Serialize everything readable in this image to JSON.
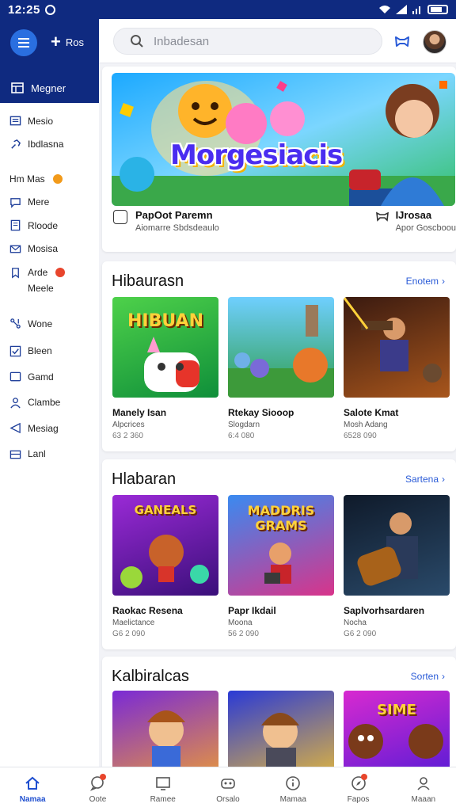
{
  "status_bar": {
    "time": "12:25"
  },
  "sidebar": {
    "new_label": "Ros",
    "active_item": "Megner",
    "items": [
      {
        "label": "Mesio",
        "icon": "list-icon"
      },
      {
        "label": "Ibdlasna",
        "icon": "link-icon"
      },
      {
        "label": "Hm Mas",
        "icon": "",
        "badge": true
      },
      {
        "label": "Mere",
        "icon": "chat-icon"
      },
      {
        "label": "Rloode",
        "icon": "document-icon"
      },
      {
        "label": "Mosisa",
        "icon": "mail-icon"
      },
      {
        "label": "Arde",
        "icon": "bookmark-icon",
        "badge": true
      },
      {
        "label": "Meele",
        "icon": ""
      },
      {
        "label": "Wone",
        "icon": "network-icon"
      },
      {
        "label": "Bleen",
        "icon": "check-icon"
      },
      {
        "label": "Gamd",
        "icon": "square-icon"
      },
      {
        "label": "Clambe",
        "icon": "person-icon"
      },
      {
        "label": "Mesiag",
        "icon": "send-icon"
      },
      {
        "label": "Lanl",
        "icon": "inbox-icon"
      }
    ]
  },
  "search": {
    "placeholder": "Inbadesan"
  },
  "hero": {
    "title": "Morgesiacis",
    "left_name": "PapOot Paremn",
    "left_sub": "Aiomarre Sbdsdeaulo",
    "right_name": "IJrosaa",
    "right_sub": "Apor Goscboou"
  },
  "sections": [
    {
      "title": "Hibaurasn",
      "see_all": "Enotem",
      "tiles": [
        {
          "name": "Manely Isan",
          "sub": "Alpcrices",
          "meta": "63 2 360",
          "img_label": "HIBUAN"
        },
        {
          "name": "Rtekay Siooop",
          "sub": "Slogdarn",
          "meta": "6:4 080",
          "img_label": ""
        },
        {
          "name": "Salote Kmat",
          "sub": "Mosh Adang",
          "meta": "6528 090",
          "img_label": ""
        }
      ]
    },
    {
      "title": "Hlabaran",
      "see_all": "Sartena",
      "tiles": [
        {
          "name": "Raokac Resena",
          "sub": "Maelictance",
          "meta": "G6 2 090",
          "img_label": "GANEALS"
        },
        {
          "name": "Papr Ikdail",
          "sub": "Moona",
          "meta": "56 2 090",
          "img_label": "MADDRIS GRAMS"
        },
        {
          "name": "Saplvorhsardaren",
          "sub": "Nocha",
          "meta": "G6 2 090",
          "img_label": ""
        }
      ]
    },
    {
      "title": "Kalbiralcas",
      "see_all": "Sorten",
      "tiles": [
        {
          "name": "",
          "sub": "",
          "meta": "",
          "img_label": ""
        },
        {
          "name": "",
          "sub": "",
          "meta": "",
          "img_label": ""
        },
        {
          "name": "",
          "sub": "",
          "meta": "",
          "img_label": "SIME"
        }
      ]
    }
  ],
  "bottom_nav": [
    {
      "label": "Namaa",
      "icon": "home-icon",
      "active": true,
      "dot": false
    },
    {
      "label": "Oote",
      "icon": "chat-icon",
      "active": false,
      "dot": true
    },
    {
      "label": "Ramee",
      "icon": "screen-icon",
      "active": false,
      "dot": false
    },
    {
      "label": "Orsalo",
      "icon": "gamepad-icon",
      "active": false,
      "dot": false
    },
    {
      "label": "Mamaa",
      "icon": "info-icon",
      "active": false,
      "dot": false
    },
    {
      "label": "Fapos",
      "icon": "compass-icon",
      "active": false,
      "dot": true
    },
    {
      "label": "Maaan",
      "icon": "profile-icon",
      "active": false,
      "dot": false
    }
  ],
  "colors": {
    "brand_dark": "#0f2a80",
    "accent_blue": "#2a6fe0",
    "badge_orange": "#f29a1a",
    "badge_red": "#e8452c",
    "link_blue": "#2a5bd7"
  }
}
